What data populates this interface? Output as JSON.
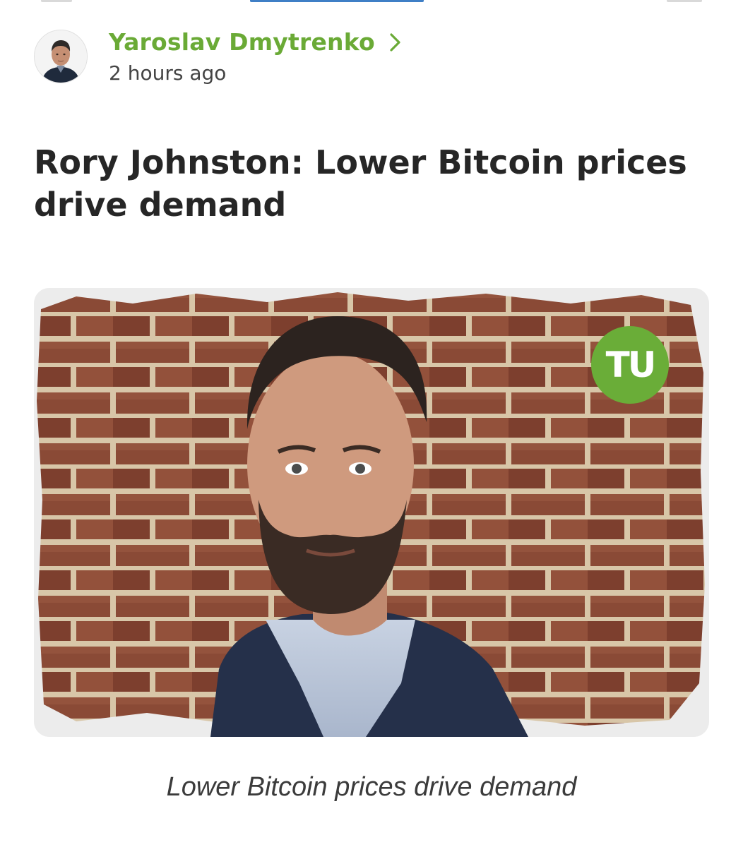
{
  "post": {
    "author_name": "Yaroslav Dmytrenko",
    "timestamp": "2 hours ago",
    "headline": "Rory Johnston: Lower Bitcoin prices drive demand"
  },
  "image": {
    "logo_text": "TU",
    "caption": "Lower Bitcoin prices drive demand"
  },
  "icons": {
    "avatar": "author-avatar-photo",
    "chevron": "chevron-right-icon"
  },
  "colors": {
    "accent_green": "#6aaa36",
    "logo_green": "#6aad38",
    "headline": "#262626",
    "muted_text": "#444444"
  }
}
